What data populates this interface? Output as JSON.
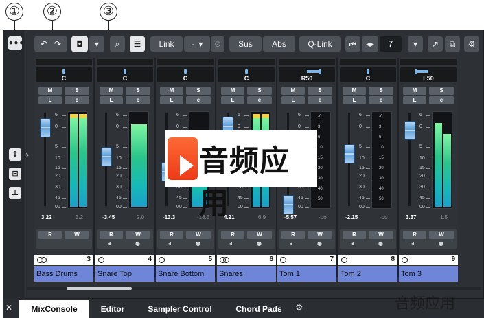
{
  "callouts": [
    "①",
    "②",
    "③"
  ],
  "toolbar": {
    "more_icon": "•••",
    "undo_icon": "↶",
    "redo_icon": "↷",
    "snapshot_icon": "◘",
    "dropdown_icon": "▾",
    "search_icon": "⌕",
    "list_icon": "☰",
    "link_label": "Link",
    "link_mode_label": "-",
    "link_mode_arrow": "▾",
    "suspend_icon": "⊘",
    "sus_label": "Sus",
    "abs_label": "Abs",
    "qlink_label": "Q-Link",
    "prev_icon": "⏮",
    "width_icon": "◂▸",
    "visible_channels": "7",
    "menu_arrow": "▾",
    "detach_icon": "↗",
    "window_settings_icon": "⧉",
    "settings_icon": "⚙"
  },
  "left_zone": {
    "mixer_icon": "↕",
    "routing_icon": "⊟",
    "output_icon": "⊥",
    "expand_icon": "›"
  },
  "scale_labels": [
    "6",
    "0",
    "5",
    "10",
    "15",
    "20",
    "30",
    "45",
    "00"
  ],
  "meter_scale_labels": [
    "-0",
    "3",
    "6",
    "10",
    "15",
    "20",
    "30",
    "40",
    "50"
  ],
  "channels": [
    {
      "name": "Bass Drums",
      "pan": "C",
      "pan_pos": 0.5,
      "fader_level": 0.93,
      "level": "3.22",
      "peak": "3.2",
      "number": "3",
      "stereo": true,
      "meter_l": 0.96,
      "meter_r": 0.96,
      "clipped": true
    },
    {
      "name": "Snare Top",
      "pan": "C",
      "pan_pos": 0.5,
      "fader_level": 0.58,
      "level": "-3.45",
      "peak": "2.0",
      "number": "4",
      "stereo": false,
      "meter_l": 0.88,
      "meter_r": 0,
      "clipped": false
    },
    {
      "name": "Snare Bottom",
      "pan": "C",
      "pan_pos": 0.5,
      "fader_level": 0.4,
      "level": "-13.3",
      "peak": "-18.5",
      "number": "5",
      "stereo": false,
      "meter_l": 0.6,
      "meter_r": 0,
      "clipped": false
    },
    {
      "name": "Snares",
      "pan": "C",
      "pan_pos": 0.5,
      "fader_level": 0.95,
      "level": "4.21",
      "peak": "6.9",
      "number": "6",
      "stereo": true,
      "meter_l": 0.96,
      "meter_r": 0.96,
      "clipped": true
    },
    {
      "name": "Tom 1",
      "pan": "R50",
      "pan_pos": 0.75,
      "fader_level": 0.0,
      "level": "-5.57",
      "peak": "-oo",
      "number": "7",
      "stereo": false,
      "meter_l": 0,
      "meter_r": 0,
      "clipped": false
    },
    {
      "name": "Tom 2",
      "pan": "C",
      "pan_pos": 0.5,
      "fader_level": 0.62,
      "level": "-2.15",
      "peak": "-oo",
      "number": "8",
      "stereo": false,
      "meter_l": 0,
      "meter_r": 0,
      "clipped": false
    },
    {
      "name": "Tom 3",
      "pan": "L50",
      "pan_pos": 0.25,
      "fader_level": 0.9,
      "level": "3.37",
      "peak": "1.5",
      "number": "9",
      "stereo": false,
      "meter_l": 0.9,
      "meter_r": 0.78,
      "clipped": false
    }
  ],
  "buttons": {
    "mute": "M",
    "solo": "S",
    "listen": "L",
    "edit": "e",
    "read": "R",
    "write": "W",
    "speaker_icon": "◂",
    "record_icon": "●"
  },
  "tabs": {
    "close_icon": "✕",
    "items": [
      "MixConsole",
      "Editor",
      "Sampler Control",
      "Chord Pads"
    ],
    "settings_icon": "⚙"
  },
  "logo": {
    "text": "音频应用"
  },
  "watermark": "音频应用"
}
